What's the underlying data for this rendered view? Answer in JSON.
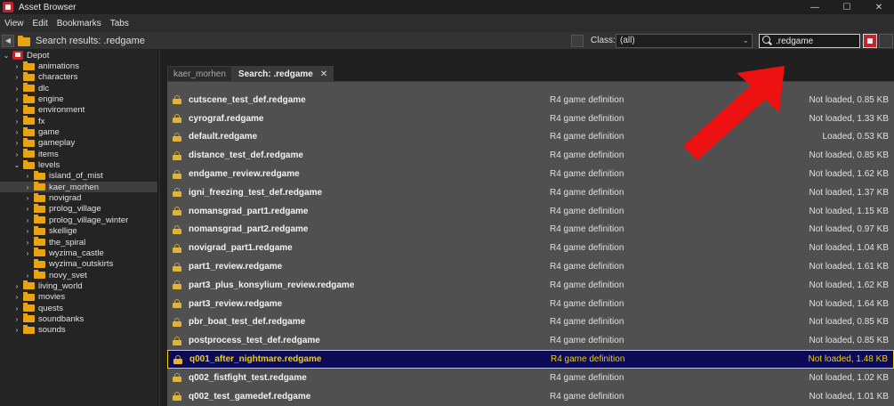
{
  "window": {
    "title": "Asset Browser",
    "minimize": "—",
    "maximize": "☐",
    "close": "✕"
  },
  "menu": [
    "View",
    "Edit",
    "Bookmarks",
    "Tabs"
  ],
  "toolbar": {
    "results_label": "Search results: .redgame",
    "class_label": "Class:",
    "class_value": "(all)",
    "search_value": ".redgame"
  },
  "tree": [
    {
      "label": "Depot",
      "depth": 0,
      "expanded": true,
      "icon": "depot"
    },
    {
      "label": "animations",
      "depth": 1
    },
    {
      "label": "characters",
      "depth": 1
    },
    {
      "label": "dlc",
      "depth": 1
    },
    {
      "label": "engine",
      "depth": 1
    },
    {
      "label": "environment",
      "depth": 1
    },
    {
      "label": "fx",
      "depth": 1
    },
    {
      "label": "game",
      "depth": 1
    },
    {
      "label": "gameplay",
      "depth": 1
    },
    {
      "label": "items",
      "depth": 1
    },
    {
      "label": "levels",
      "depth": 1,
      "expanded": true
    },
    {
      "label": "island_of_mist",
      "depth": 2
    },
    {
      "label": "kaer_morhen",
      "depth": 2,
      "selected": true
    },
    {
      "label": "novigrad",
      "depth": 2
    },
    {
      "label": "prolog_village",
      "depth": 2
    },
    {
      "label": "prolog_village_winter",
      "depth": 2
    },
    {
      "label": "skellige",
      "depth": 2
    },
    {
      "label": "the_spiral",
      "depth": 2
    },
    {
      "label": "wyzima_castle",
      "depth": 2
    },
    {
      "label": "wyzima_outskirts",
      "depth": 2,
      "leaf": true
    },
    {
      "label": "novy_svet",
      "depth": 2
    },
    {
      "label": "living_world",
      "depth": 1
    },
    {
      "label": "movies",
      "depth": 1
    },
    {
      "label": "quests",
      "depth": 1
    },
    {
      "label": "soundbanks",
      "depth": 1
    },
    {
      "label": "sounds",
      "depth": 1
    }
  ],
  "tabs": [
    {
      "label": "kaer_morhen",
      "active": false
    },
    {
      "label": "Search: .redgame",
      "active": true,
      "close": "✕"
    }
  ],
  "files": [
    {
      "name": "cutscene_test_def.redgame",
      "type": "R4 game definition",
      "status": "Not loaded, 0.85 KB"
    },
    {
      "name": "cyrograf.redgame",
      "type": "R4 game definition",
      "status": "Not loaded, 1.33 KB"
    },
    {
      "name": "default.redgame",
      "type": "R4 game definition",
      "status": "Loaded, 0.53 KB"
    },
    {
      "name": "distance_test_def.redgame",
      "type": "R4 game definition",
      "status": "Not loaded, 0.85 KB"
    },
    {
      "name": "endgame_review.redgame",
      "type": "R4 game definition",
      "status": "Not loaded, 1.62 KB"
    },
    {
      "name": "igni_freezing_test_def.redgame",
      "type": "R4 game definition",
      "status": "Not loaded, 1.37 KB"
    },
    {
      "name": "nomansgrad_part1.redgame",
      "type": "R4 game definition",
      "status": "Not loaded, 1.15 KB"
    },
    {
      "name": "nomansgrad_part2.redgame",
      "type": "R4 game definition",
      "status": "Not loaded, 0.97 KB"
    },
    {
      "name": "novigrad_part1.redgame",
      "type": "R4 game definition",
      "status": "Not loaded, 1.04 KB"
    },
    {
      "name": "part1_review.redgame",
      "type": "R4 game definition",
      "status": "Not loaded, 1.61 KB"
    },
    {
      "name": "part3_plus_konsylium_review.redgame",
      "type": "R4 game definition",
      "status": "Not loaded, 1.62 KB"
    },
    {
      "name": "part3_review.redgame",
      "type": "R4 game definition",
      "status": "Not loaded, 1.64 KB"
    },
    {
      "name": "pbr_boat_test_def.redgame",
      "type": "R4 game definition",
      "status": "Not loaded, 0.85 KB"
    },
    {
      "name": "postprocess_test_def.redgame",
      "type": "R4 game definition",
      "status": "Not loaded, 0.85 KB"
    },
    {
      "name": "q001_after_nightmare.redgame",
      "type": "R4 game definition",
      "status": "Not loaded, 1.48 KB",
      "selected": true
    },
    {
      "name": "q002_fistfight_test.redgame",
      "type": "R4 game definition",
      "status": "Not loaded, 1.02 KB"
    },
    {
      "name": "q002_test_gamedef.redgame",
      "type": "R4 game definition",
      "status": "Not loaded, 1.01 KB"
    }
  ],
  "colors": {
    "accent_red": "#c0262b",
    "folder": "#e8a317",
    "selection_border": "#f4d000",
    "selection_bg": "#0a0a56",
    "annotation_arrow": "#ee1111"
  }
}
